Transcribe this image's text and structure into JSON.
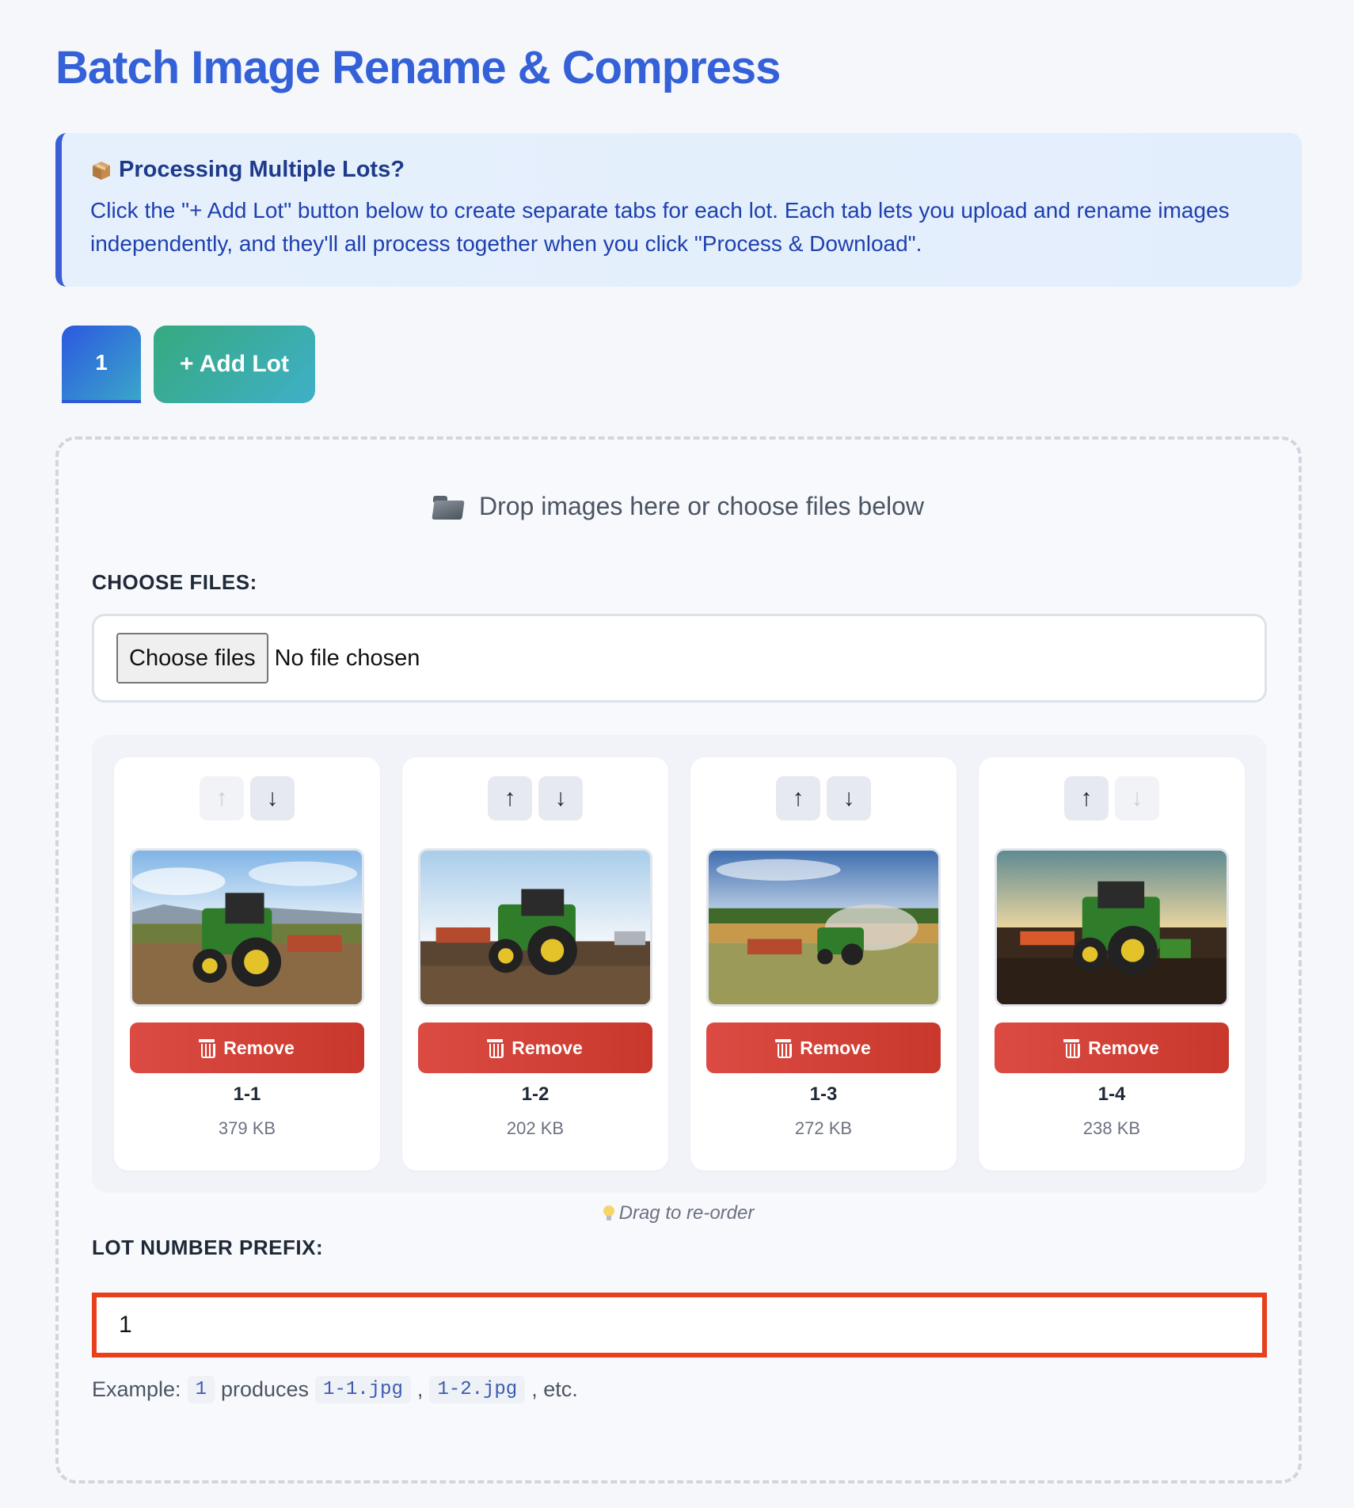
{
  "header": {
    "title": "Batch Image Rename & Compress"
  },
  "info": {
    "icon": "package-icon",
    "title": "Processing Multiple Lots?",
    "text": "Click the \"+ Add Lot\" button below to create separate tabs for each lot. Each tab lets you upload and rename images independently, and they'll all process together when you click \"Process & Download\"."
  },
  "tabs": {
    "items": [
      {
        "label": "1",
        "active": true
      }
    ],
    "add_label": "+ Add Lot"
  },
  "dropzone": {
    "hint": "Drop images here or choose files below",
    "choose_label": "CHOOSE FILES:",
    "file_button": "Choose files",
    "file_status": "No file chosen",
    "drag_hint": "Drag to re-order"
  },
  "images": [
    {
      "name": "1-1",
      "size": "379 KB",
      "remove_label": "Remove",
      "up_enabled": false,
      "down_enabled": true
    },
    {
      "name": "1-2",
      "size": "202 KB",
      "remove_label": "Remove",
      "up_enabled": true,
      "down_enabled": true
    },
    {
      "name": "1-3",
      "size": "272 KB",
      "remove_label": "Remove",
      "up_enabled": true,
      "down_enabled": true
    },
    {
      "name": "1-4",
      "size": "238 KB",
      "remove_label": "Remove",
      "up_enabled": true,
      "down_enabled": false
    }
  ],
  "prefix": {
    "label": "LOT NUMBER PREFIX:",
    "value": "1",
    "example_prefix": "Example:",
    "example_code1": "1",
    "example_mid": "produces",
    "example_code2": "1-1.jpg",
    "example_sep": ",",
    "example_code3": "1-2.jpg",
    "example_suffix": ", etc."
  },
  "colors": {
    "accent": "#3461d8",
    "add_lot": "#36a97f",
    "remove": "#dc4b43",
    "focus_border": "#e8401d"
  }
}
